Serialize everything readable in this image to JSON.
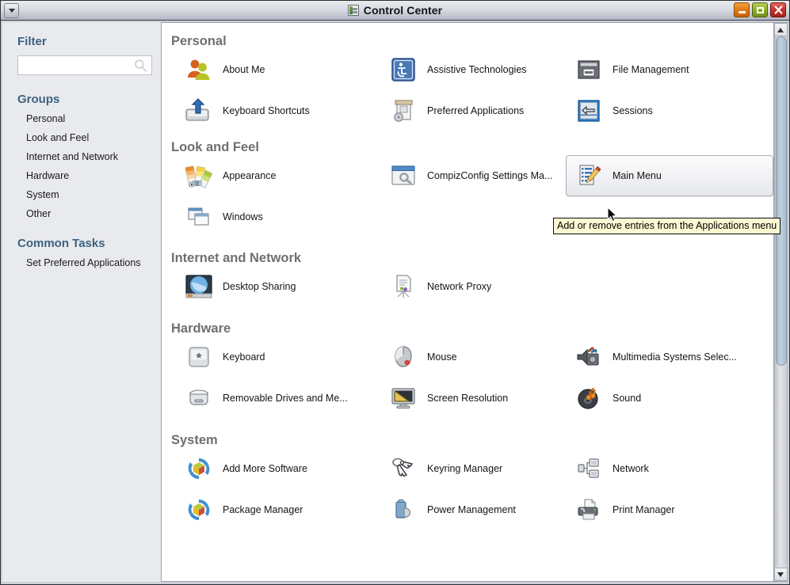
{
  "window": {
    "title": "Control Center",
    "title_icon": "control-center-icon",
    "menu_button_icon": "window-menu-caret-icon",
    "buttons": {
      "minimize": "minimize-icon",
      "maximize": "maximize-icon",
      "close": "close-icon"
    }
  },
  "sidebar": {
    "filter_heading": "Filter",
    "filter_value": "",
    "filter_placeholder": "",
    "filter_icon": "search-icon",
    "groups_heading": "Groups",
    "groups": [
      {
        "label": "Personal"
      },
      {
        "label": "Look and Feel"
      },
      {
        "label": "Internet and Network"
      },
      {
        "label": "Hardware"
      },
      {
        "label": "System"
      },
      {
        "label": "Other"
      }
    ],
    "common_tasks_heading": "Common Tasks",
    "common_tasks": [
      {
        "label": "Set Preferred Applications"
      }
    ]
  },
  "content": {
    "sections": [
      {
        "title": "Personal",
        "items": [
          {
            "label": "About Me",
            "icon": "users-icon",
            "hover": false
          },
          {
            "label": "Assistive Technologies",
            "icon": "accessibility-icon",
            "hover": false
          },
          {
            "label": "File Management",
            "icon": "file-cabinet-icon",
            "hover": false
          },
          {
            "label": "Keyboard Shortcuts",
            "icon": "keyboard-shortcut-icon",
            "hover": false
          },
          {
            "label": "Preferred Applications",
            "icon": "preferred-apps-icon",
            "hover": false
          },
          {
            "label": "Sessions",
            "icon": "sessions-icon",
            "hover": false
          }
        ]
      },
      {
        "title": "Look and Feel",
        "items": [
          {
            "label": "Appearance",
            "icon": "color-swatch-icon",
            "hover": false
          },
          {
            "label": "CompizConfig Settings Ma...",
            "icon": "compiz-window-wrench-icon",
            "hover": false
          },
          {
            "label": "Main Menu",
            "icon": "menu-edit-pencil-icon",
            "hover": true
          },
          {
            "label": "Windows",
            "icon": "windows-stack-icon",
            "hover": false
          }
        ]
      },
      {
        "title": "Internet and Network",
        "items": [
          {
            "label": "Desktop Sharing",
            "icon": "globe-monitor-icon",
            "hover": false
          },
          {
            "label": "Network Proxy",
            "icon": "proxy-certificate-icon",
            "hover": false
          }
        ]
      },
      {
        "title": "Hardware",
        "items": [
          {
            "label": "Keyboard",
            "icon": "keyboard-key-icon",
            "hover": false
          },
          {
            "label": "Mouse",
            "icon": "mouse-icon",
            "hover": false
          },
          {
            "label": "Multimedia Systems Selec...",
            "icon": "multimedia-speaker-icon",
            "hover": false
          },
          {
            "label": "Removable Drives and Me...",
            "icon": "removable-drive-icon",
            "hover": false
          },
          {
            "label": "Screen Resolution",
            "icon": "monitor-ruler-icon",
            "hover": false
          },
          {
            "label": "Sound",
            "icon": "sound-note-icon",
            "hover": false
          }
        ]
      },
      {
        "title": "System",
        "items": [
          {
            "label": "Add More Software",
            "icon": "package-refresh-icon",
            "hover": false
          },
          {
            "label": "Keyring Manager",
            "icon": "keyring-keys-icon",
            "hover": false
          },
          {
            "label": "Network",
            "icon": "network-nodes-icon",
            "hover": false
          },
          {
            "label": "Package Manager",
            "icon": "package-refresh-icon",
            "hover": false
          },
          {
            "label": "Power Management",
            "icon": "battery-power-icon",
            "hover": false
          },
          {
            "label": "Print Manager",
            "icon": "printer-icon",
            "hover": false
          }
        ]
      }
    ]
  },
  "tooltip": {
    "text": "Add or remove entries from the Applications menu"
  },
  "scrollbar": {
    "thumb_percent": 62,
    "up_arrow_icon": "scroll-up-arrow-icon",
    "down_arrow_icon": "scroll-down-arrow-icon"
  },
  "colors": {
    "sidebar_bg": "#e8eaed",
    "heading_blue": "#3e6283",
    "group_title_gray": "#6f6f6f",
    "tooltip_bg": "#fbf8d2",
    "close_red": "#c5352c",
    "maximize_green": "#8fae2d",
    "minimize_orange": "#e07a15"
  }
}
